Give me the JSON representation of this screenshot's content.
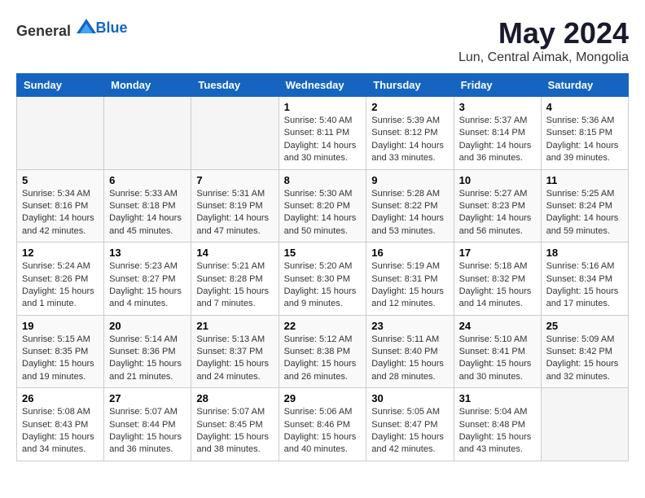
{
  "header": {
    "logo_general": "General",
    "logo_blue": "Blue",
    "month_year": "May 2024",
    "location": "Lun, Central Aimak, Mongolia"
  },
  "weekdays": [
    "Sunday",
    "Monday",
    "Tuesday",
    "Wednesday",
    "Thursday",
    "Friday",
    "Saturday"
  ],
  "weeks": [
    [
      {
        "day": "",
        "info": ""
      },
      {
        "day": "",
        "info": ""
      },
      {
        "day": "",
        "info": ""
      },
      {
        "day": "1",
        "info": "Sunrise: 5:40 AM\nSunset: 8:11 PM\nDaylight: 14 hours\nand 30 minutes."
      },
      {
        "day": "2",
        "info": "Sunrise: 5:39 AM\nSunset: 8:12 PM\nDaylight: 14 hours\nand 33 minutes."
      },
      {
        "day": "3",
        "info": "Sunrise: 5:37 AM\nSunset: 8:14 PM\nDaylight: 14 hours\nand 36 minutes."
      },
      {
        "day": "4",
        "info": "Sunrise: 5:36 AM\nSunset: 8:15 PM\nDaylight: 14 hours\nand 39 minutes."
      }
    ],
    [
      {
        "day": "5",
        "info": "Sunrise: 5:34 AM\nSunset: 8:16 PM\nDaylight: 14 hours\nand 42 minutes."
      },
      {
        "day": "6",
        "info": "Sunrise: 5:33 AM\nSunset: 8:18 PM\nDaylight: 14 hours\nand 45 minutes."
      },
      {
        "day": "7",
        "info": "Sunrise: 5:31 AM\nSunset: 8:19 PM\nDaylight: 14 hours\nand 47 minutes."
      },
      {
        "day": "8",
        "info": "Sunrise: 5:30 AM\nSunset: 8:20 PM\nDaylight: 14 hours\nand 50 minutes."
      },
      {
        "day": "9",
        "info": "Sunrise: 5:28 AM\nSunset: 8:22 PM\nDaylight: 14 hours\nand 53 minutes."
      },
      {
        "day": "10",
        "info": "Sunrise: 5:27 AM\nSunset: 8:23 PM\nDaylight: 14 hours\nand 56 minutes."
      },
      {
        "day": "11",
        "info": "Sunrise: 5:25 AM\nSunset: 8:24 PM\nDaylight: 14 hours\nand 59 minutes."
      }
    ],
    [
      {
        "day": "12",
        "info": "Sunrise: 5:24 AM\nSunset: 8:26 PM\nDaylight: 15 hours\nand 1 minute."
      },
      {
        "day": "13",
        "info": "Sunrise: 5:23 AM\nSunset: 8:27 PM\nDaylight: 15 hours\nand 4 minutes."
      },
      {
        "day": "14",
        "info": "Sunrise: 5:21 AM\nSunset: 8:28 PM\nDaylight: 15 hours\nand 7 minutes."
      },
      {
        "day": "15",
        "info": "Sunrise: 5:20 AM\nSunset: 8:30 PM\nDaylight: 15 hours\nand 9 minutes."
      },
      {
        "day": "16",
        "info": "Sunrise: 5:19 AM\nSunset: 8:31 PM\nDaylight: 15 hours\nand 12 minutes."
      },
      {
        "day": "17",
        "info": "Sunrise: 5:18 AM\nSunset: 8:32 PM\nDaylight: 15 hours\nand 14 minutes."
      },
      {
        "day": "18",
        "info": "Sunrise: 5:16 AM\nSunset: 8:34 PM\nDaylight: 15 hours\nand 17 minutes."
      }
    ],
    [
      {
        "day": "19",
        "info": "Sunrise: 5:15 AM\nSunset: 8:35 PM\nDaylight: 15 hours\nand 19 minutes."
      },
      {
        "day": "20",
        "info": "Sunrise: 5:14 AM\nSunset: 8:36 PM\nDaylight: 15 hours\nand 21 minutes."
      },
      {
        "day": "21",
        "info": "Sunrise: 5:13 AM\nSunset: 8:37 PM\nDaylight: 15 hours\nand 24 minutes."
      },
      {
        "day": "22",
        "info": "Sunrise: 5:12 AM\nSunset: 8:38 PM\nDaylight: 15 hours\nand 26 minutes."
      },
      {
        "day": "23",
        "info": "Sunrise: 5:11 AM\nSunset: 8:40 PM\nDaylight: 15 hours\nand 28 minutes."
      },
      {
        "day": "24",
        "info": "Sunrise: 5:10 AM\nSunset: 8:41 PM\nDaylight: 15 hours\nand 30 minutes."
      },
      {
        "day": "25",
        "info": "Sunrise: 5:09 AM\nSunset: 8:42 PM\nDaylight: 15 hours\nand 32 minutes."
      }
    ],
    [
      {
        "day": "26",
        "info": "Sunrise: 5:08 AM\nSunset: 8:43 PM\nDaylight: 15 hours\nand 34 minutes."
      },
      {
        "day": "27",
        "info": "Sunrise: 5:07 AM\nSunset: 8:44 PM\nDaylight: 15 hours\nand 36 minutes."
      },
      {
        "day": "28",
        "info": "Sunrise: 5:07 AM\nSunset: 8:45 PM\nDaylight: 15 hours\nand 38 minutes."
      },
      {
        "day": "29",
        "info": "Sunrise: 5:06 AM\nSunset: 8:46 PM\nDaylight: 15 hours\nand 40 minutes."
      },
      {
        "day": "30",
        "info": "Sunrise: 5:05 AM\nSunset: 8:47 PM\nDaylight: 15 hours\nand 42 minutes."
      },
      {
        "day": "31",
        "info": "Sunrise: 5:04 AM\nSunset: 8:48 PM\nDaylight: 15 hours\nand 43 minutes."
      },
      {
        "day": "",
        "info": ""
      }
    ]
  ]
}
